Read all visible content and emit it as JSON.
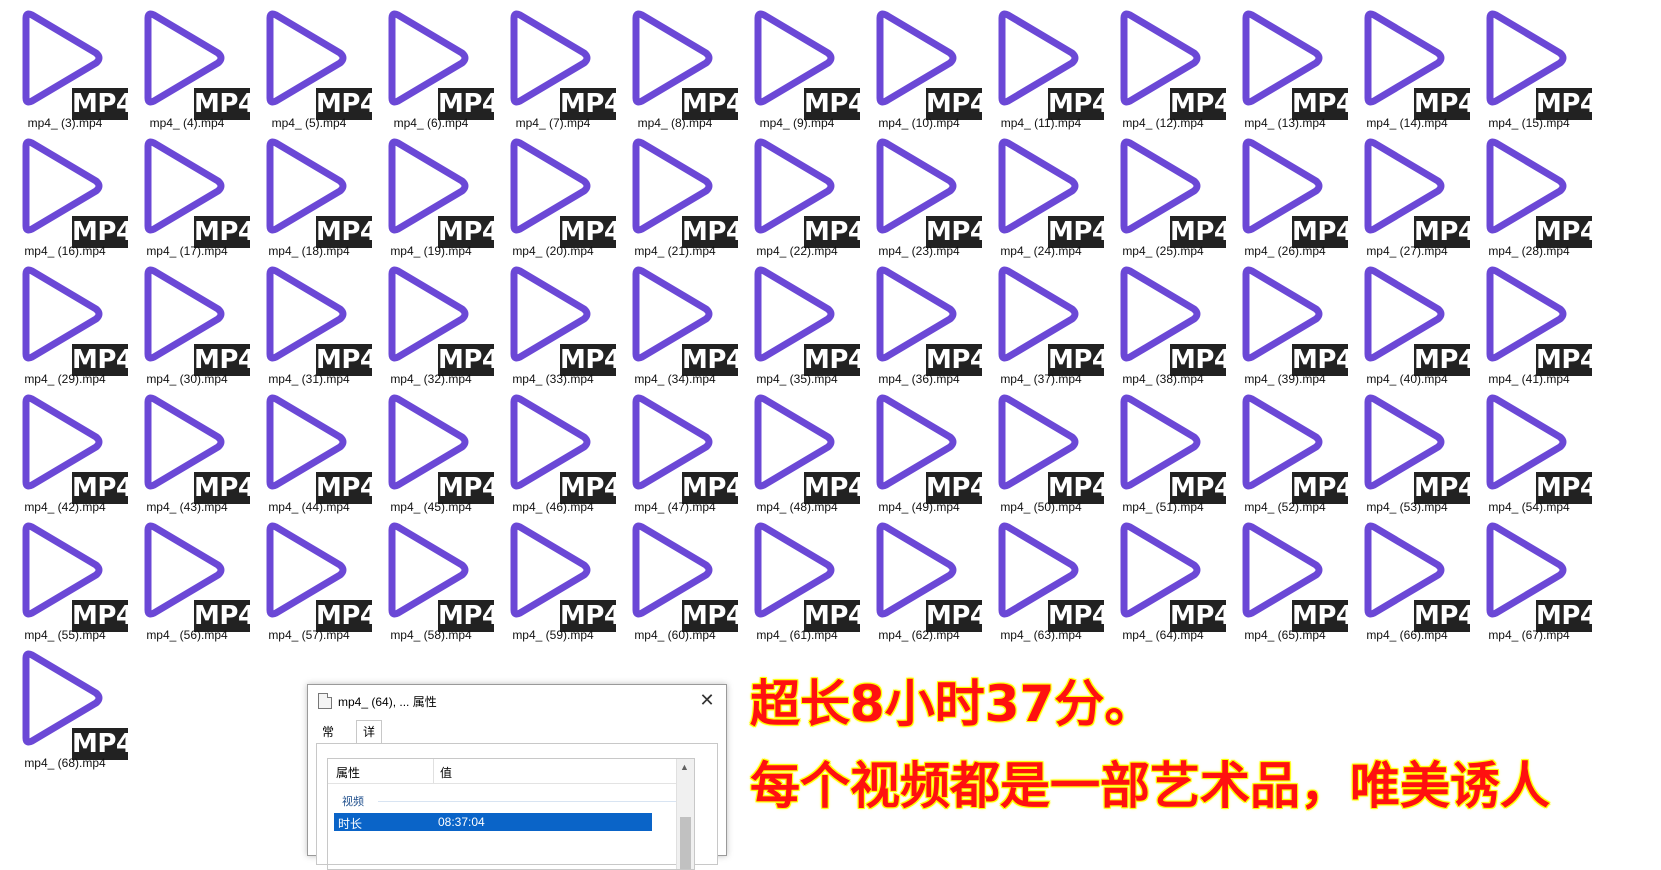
{
  "files": [
    "mp4_ (3).mp4",
    "mp4_ (4).mp4",
    "mp4_ (5).mp4",
    "mp4_ (6).mp4",
    "mp4_ (7).mp4",
    "mp4_ (8).mp4",
    "mp4_ (9).mp4",
    "mp4_ (10).mp4",
    "mp4_ (11).mp4",
    "mp4_ (12).mp4",
    "mp4_ (13).mp4",
    "mp4_ (14).mp4",
    "mp4_ (15).mp4",
    "mp4_ (16).mp4",
    "mp4_ (17).mp4",
    "mp4_ (18).mp4",
    "mp4_ (19).mp4",
    "mp4_ (20).mp4",
    "mp4_ (21).mp4",
    "mp4_ (22).mp4",
    "mp4_ (23).mp4",
    "mp4_ (24).mp4",
    "mp4_ (25).mp4",
    "mp4_ (26).mp4",
    "mp4_ (27).mp4",
    "mp4_ (28).mp4",
    "mp4_ (29).mp4",
    "mp4_ (30).mp4",
    "mp4_ (31).mp4",
    "mp4_ (32).mp4",
    "mp4_ (33).mp4",
    "mp4_ (34).mp4",
    "mp4_ (35).mp4",
    "mp4_ (36).mp4",
    "mp4_ (37).mp4",
    "mp4_ (38).mp4",
    "mp4_ (39).mp4",
    "mp4_ (40).mp4",
    "mp4_ (41).mp4",
    "mp4_ (42).mp4",
    "mp4_ (43).mp4",
    "mp4_ (44).mp4",
    "mp4_ (45).mp4",
    "mp4_ (46).mp4",
    "mp4_ (47).mp4",
    "mp4_ (48).mp4",
    "mp4_ (49).mp4",
    "mp4_ (50).mp4",
    "mp4_ (51).mp4",
    "mp4_ (52).mp4",
    "mp4_ (53).mp4",
    "mp4_ (54).mp4",
    "mp4_ (55).mp4",
    "mp4_ (56).mp4",
    "mp4_ (57).mp4",
    "mp4_ (58).mp4",
    "mp4_ (59).mp4",
    "mp4_ (60).mp4",
    "mp4_ (61).mp4",
    "mp4_ (62).mp4",
    "mp4_ (63).mp4",
    "mp4_ (64).mp4",
    "mp4_ (65).mp4",
    "mp4_ (66).mp4",
    "mp4_ (67).mp4",
    "mp4_ (68).mp4"
  ],
  "file_icon": {
    "name": "video-file-icon",
    "badge": "MP4",
    "play_color": "#6b48d6",
    "badge_color": "#222222"
  },
  "dialog": {
    "title": "mp4_ (64), ... 属性",
    "close_glyph": "✕",
    "tabs": [
      "常规",
      "详细信息"
    ],
    "active_tab": "详细信息",
    "columns": [
      "属性",
      "值"
    ],
    "group": "视频",
    "selected_row": {
      "property": "时长",
      "value": "08:37:04"
    },
    "scroll_up_glyph": "▲"
  },
  "promo": {
    "line1": "超长8小时37分。",
    "line2": "每个视频都是一部艺术品，唯美诱人",
    "color": "#ff1010",
    "glow": "#ffff00"
  }
}
